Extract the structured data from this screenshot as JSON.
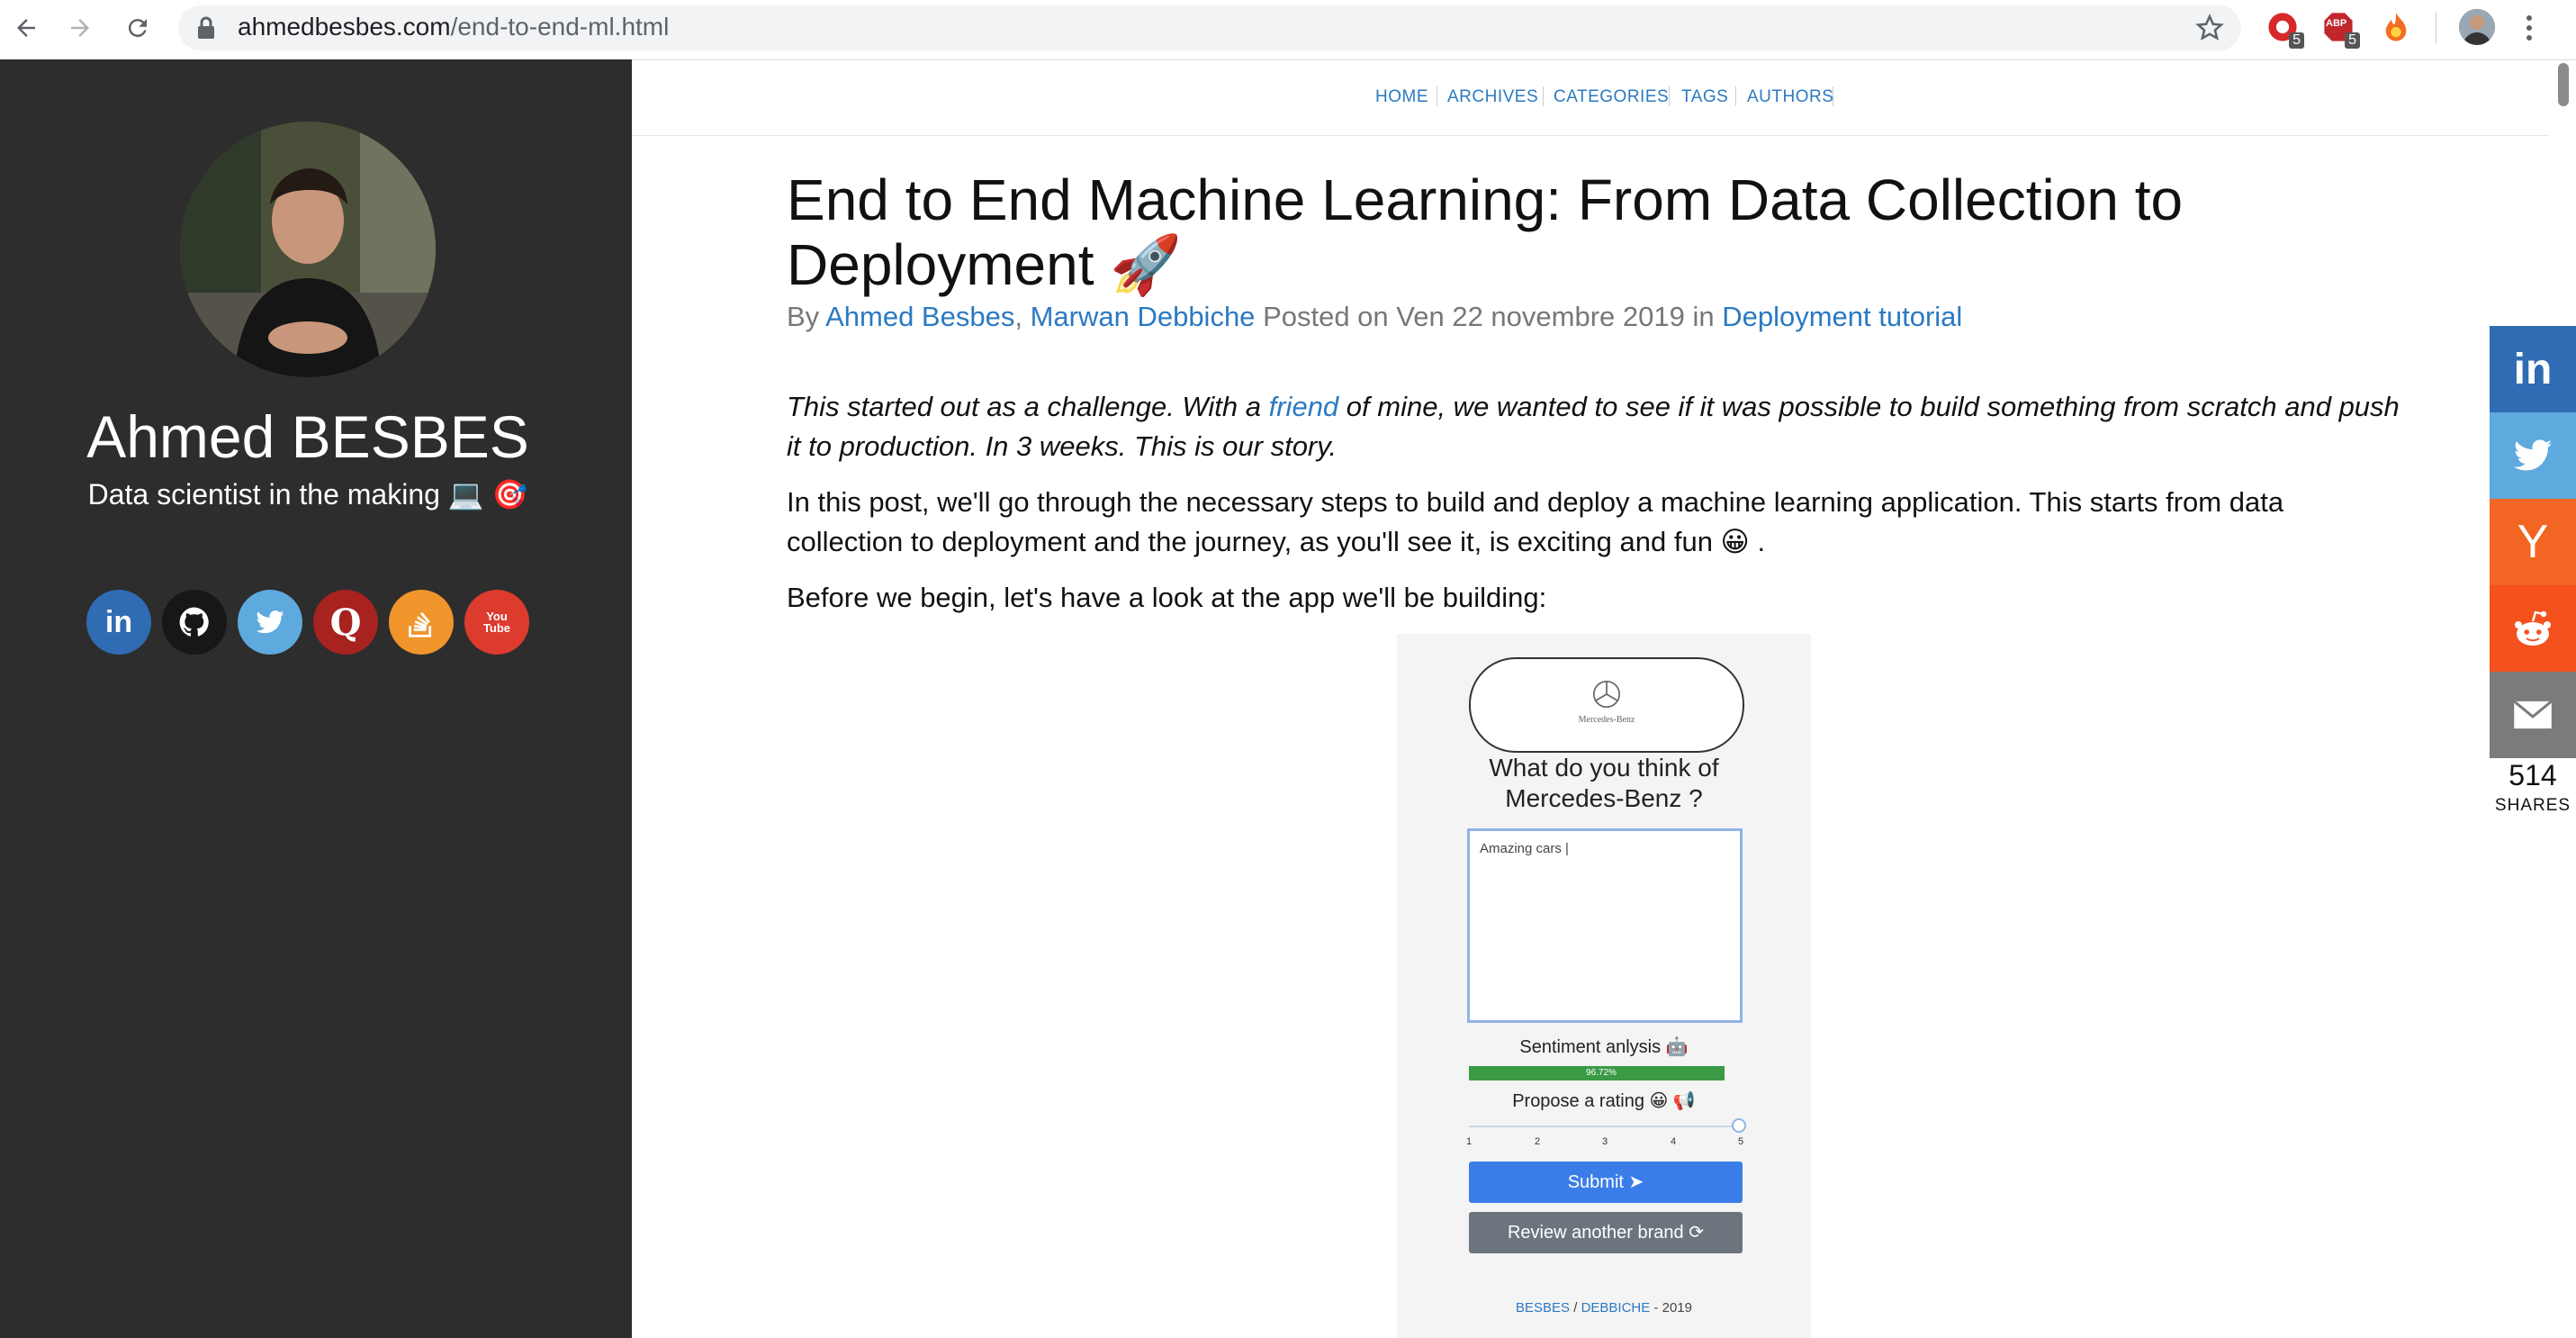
{
  "browser": {
    "url_domain": "ahmedbesbes.com",
    "url_path": "/end-to-end-ml.html",
    "ext_badges": [
      "5",
      "5"
    ],
    "ext_adblock_label": "ABP"
  },
  "sidebar": {
    "name": "Ahmed BESBES",
    "tagline": "Data scientist in the making 💻 🎯",
    "socials": [
      {
        "icon": "linkedin-icon",
        "glyph": "in",
        "color": "#2f6cb3"
      },
      {
        "icon": "github-icon",
        "glyph": "",
        "color": "#171717"
      },
      {
        "icon": "twitter-icon",
        "glyph": "",
        "color": "#5ea9dd"
      },
      {
        "icon": "quora-icon",
        "glyph": "Q",
        "color": "#a8221f"
      },
      {
        "icon": "stackoverflow-icon",
        "glyph": "",
        "color": "#f0952b"
      },
      {
        "icon": "youtube-icon",
        "glyph": "You\nTube",
        "color": "#dc3b2e"
      }
    ]
  },
  "topnav": {
    "items": [
      "HOME",
      "ARCHIVES",
      "CATEGORIES",
      "TAGS",
      "AUTHORS"
    ]
  },
  "post": {
    "title": "End to End Machine Learning: From Data Collection to Deployment 🚀",
    "meta_by": "By",
    "author1": "Ahmed Besbes",
    "comma": ",",
    "author2": "Marwan Debbiche",
    "posted_on": "Posted on Ven 22 novembre 2019 in",
    "category": "Deployment tutorial",
    "intro_part1": "This started out as a challenge. With a",
    "intro_link": "friend",
    "intro_part2": "of mine, we wanted to see if it was possible to build something from scratch and push it to production. In 3 weeks. This is our story.",
    "para1": "In this post, we'll go through the necessary steps to build and deploy a machine learning application. This starts from data collection to deployment and the journey, as you'll see it, is exciting and fun 😀 .",
    "para2": "Before we begin, let's have a look at the app we'll be building:"
  },
  "app": {
    "logo_text": "Mercedes-Benz",
    "question": "What do you think of Mercedes-Benz ?",
    "textarea_value": "Amazing cars |",
    "sentiment_label": "Sentiment anlysis 🤖",
    "sentiment_value": "96.72%",
    "sentiment_fraction": 0.9672,
    "rating_label": "Propose a rating 😀 📢",
    "rating_ticks": [
      "1",
      "2",
      "3",
      "4",
      "5"
    ],
    "rating_value": 5,
    "submit_label": "Submit",
    "review_label": "Review another brand",
    "footer_b1": "BESBES",
    "footer_sep": " / ",
    "footer_b2": "DEBBICHE",
    "footer_year": " - 2019"
  },
  "share": {
    "count": "514",
    "label": "SHARES",
    "buttons": [
      {
        "icon": "linkedin-share-icon",
        "color": "#2f6cb3"
      },
      {
        "icon": "twitter-share-icon",
        "color": "#5ea9dd"
      },
      {
        "icon": "hackernews-share-icon",
        "color": "#f26522"
      },
      {
        "icon": "reddit-share-icon",
        "color": "#f4511e"
      },
      {
        "icon": "email-share-icon",
        "color": "#7b7b7b"
      }
    ]
  }
}
